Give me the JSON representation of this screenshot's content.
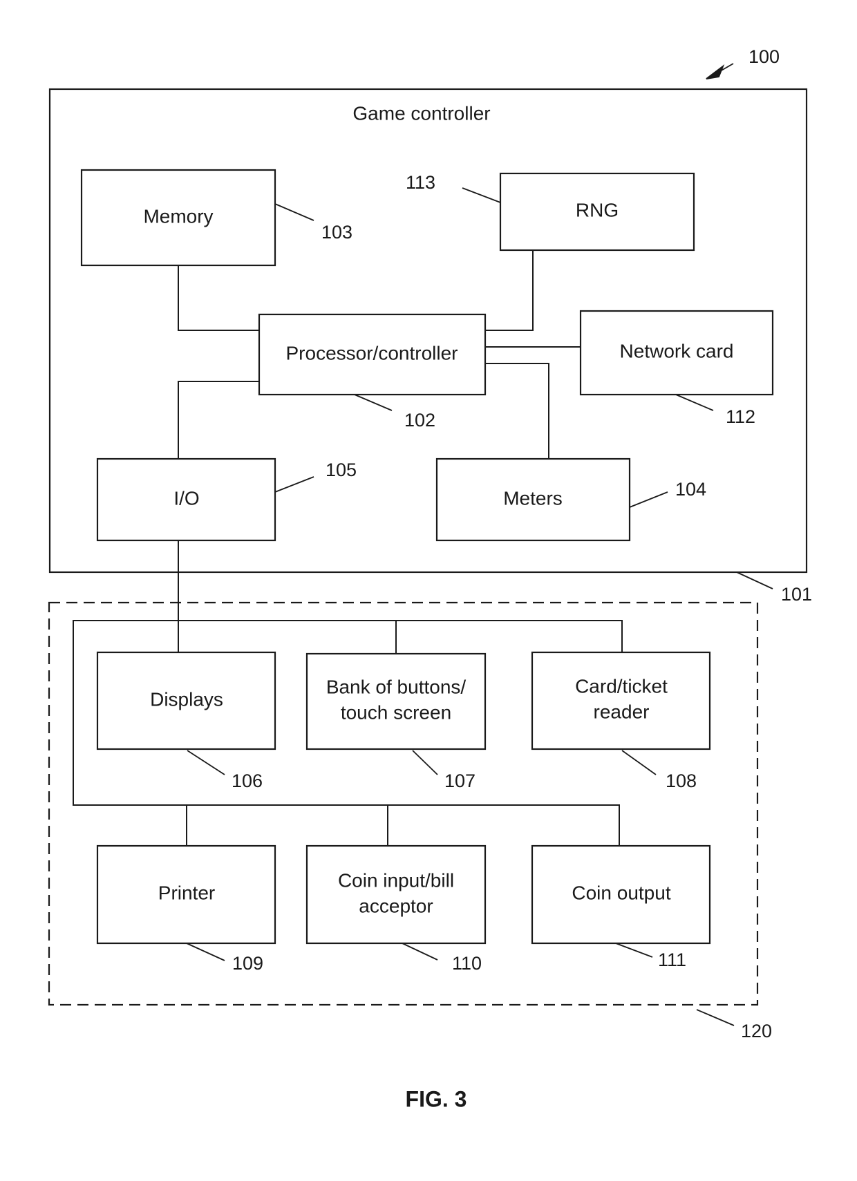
{
  "figure": {
    "caption": "FIG. 3",
    "system_ref": "100"
  },
  "game_controller": {
    "title": "Game controller",
    "ref": "101",
    "components": {
      "memory": {
        "label": "Memory",
        "ref": "103"
      },
      "rng": {
        "label": "RNG",
        "ref": "113"
      },
      "processor": {
        "label": "Processor/controller",
        "ref": "102"
      },
      "network_card": {
        "label": "Network card",
        "ref": "112"
      },
      "io": {
        "label": "I/O",
        "ref": "105"
      },
      "meters": {
        "label": "Meters",
        "ref": "104"
      }
    }
  },
  "peripherals": {
    "ref": "120",
    "components": {
      "displays": {
        "lines": [
          "Displays"
        ],
        "ref": "106"
      },
      "buttons": {
        "lines": [
          "Bank of buttons/",
          "touch screen"
        ],
        "ref": "107"
      },
      "card_reader": {
        "lines": [
          "Card/ticket",
          "reader"
        ],
        "ref": "108"
      },
      "printer": {
        "lines": [
          "Printer"
        ],
        "ref": "109"
      },
      "coin_input": {
        "lines": [
          "Coin input/bill",
          "acceptor"
        ],
        "ref": "110"
      },
      "coin_output": {
        "lines": [
          "Coin output"
        ],
        "ref": "111"
      }
    }
  }
}
